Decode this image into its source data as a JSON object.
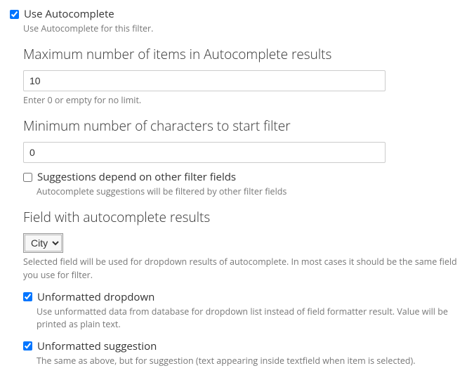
{
  "use_autocomplete": {
    "label": "Use Autocomplete",
    "checked": true,
    "description": "Use Autocomplete for this filter."
  },
  "max_items": {
    "label": "Maximum number of items in Autocomplete results",
    "value": "10",
    "description": "Enter 0 or empty for no limit."
  },
  "min_chars": {
    "label": "Minimum number of characters to start filter",
    "value": "0"
  },
  "suggestions_depend": {
    "label": "Suggestions depend on other filter fields",
    "checked": false,
    "description": "Autocomplete suggestions will be filtered by other filter fields"
  },
  "field_results": {
    "label": "Field with autocomplete results",
    "value": "City",
    "description": "Selected field will be used for dropdown results of autocomplete. In most cases it should be the same field you use for filter."
  },
  "unformatted_dropdown": {
    "label": "Unformatted dropdown",
    "checked": true,
    "description": "Use unformatted data from database for dropdown list instead of field formatter result. Value will be printed as plain text."
  },
  "unformatted_suggestion": {
    "label": "Unformatted suggestion",
    "checked": true,
    "description": "The same as above, but for suggestion (text appearing inside textfield when item is selected)."
  }
}
